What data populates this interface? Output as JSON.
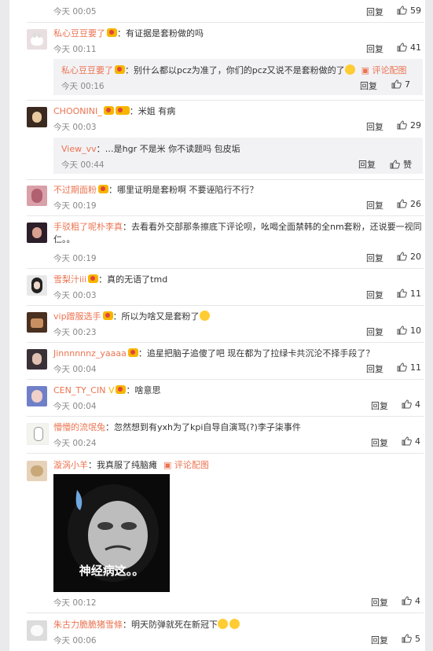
{
  "comments": [
    {
      "id": "c0",
      "time": "今天 00:05",
      "reply": "回复",
      "likes": "59"
    },
    {
      "id": "c1",
      "user": "私心豆豆要了",
      "text": "：有证据是套粉做的吗",
      "time": "今天 00:11",
      "reply": "回复",
      "likes": "41",
      "sub": {
        "user": "私心豆豆要了",
        "text": "：别什么都以pcz为准了，你们的pcz又说不是套粉做的了",
        "link": "评论配图",
        "time": "今天 00:16",
        "reply": "回复",
        "likes": "7"
      }
    },
    {
      "id": "c2",
      "user": "CHOONINI_",
      "text": "：米姐 有病",
      "time": "今天 00:03",
      "reply": "回复",
      "likes": "29",
      "sub": {
        "user": "View_vv",
        "text": "：…是hgr 不是米 你不读题吗 包皮垢",
        "time": "今天 00:44",
        "reply": "回复",
        "likes": "赞"
      }
    },
    {
      "id": "c3",
      "user": "不过期面粉",
      "text": "：哪里证明是套粉啊 不要诬陷行不行？",
      "time": "今天 00:19",
      "reply": "回复",
      "likes": "26"
    },
    {
      "id": "c4",
      "user": "手驳粗了呢朴李真",
      "text": "：去看看外交部那条擦底下评论呗，吆喝全面禁韩的全nm套粉，还说要一视同",
      "text2": "仁。。",
      "time": "今天 00:19",
      "reply": "回复",
      "likes": "20"
    },
    {
      "id": "c5",
      "user": "雪梨汁iii",
      "text": "：真的无语了tmd",
      "time": "今天 00:03",
      "reply": "回复",
      "likes": "11"
    },
    {
      "id": "c6",
      "user": "vip蹭服选手",
      "text": "：所以为啥又是套粉了",
      "time": "今天 00:23",
      "reply": "回复",
      "likes": "10"
    },
    {
      "id": "c7",
      "user": "Jinnnnnnz_yaaaa",
      "text": "：追星把脑子追傻了吧  现在都为了拉绿卡共沉沦不择手段了？",
      "time": "今天 00:04",
      "reply": "回复",
      "likes": "11"
    },
    {
      "id": "c8",
      "user": "CEN_TY_CIN",
      "text": "：啥意思",
      "time": "今天 00:04",
      "reply": "回复",
      "likes": "4"
    },
    {
      "id": "c9",
      "user": "懵懵的流氓兔",
      "text": "：忽然想到有yxh为了kpi自导自演骂(?)李子柒事件",
      "time": "今天 00:24",
      "reply": "回复",
      "likes": "4"
    },
    {
      "id": "c10",
      "user": "漩涡小羊",
      "text": "：我真服了纯脑瘫",
      "link": "评论配图",
      "pic_caption": "神经病这。。",
      "time": "今天 00:12",
      "reply": "回复",
      "likes": "4"
    },
    {
      "id": "c11",
      "user": "朱古力脆脆猪雪條",
      "text": "：明天防弹就死在新冠下",
      "time": "今天 00:06",
      "reply": "回复",
      "likes": "5"
    }
  ],
  "colors": {
    "name": "#eb7350",
    "time": "#888888",
    "subbg": "#f2f2f5"
  }
}
